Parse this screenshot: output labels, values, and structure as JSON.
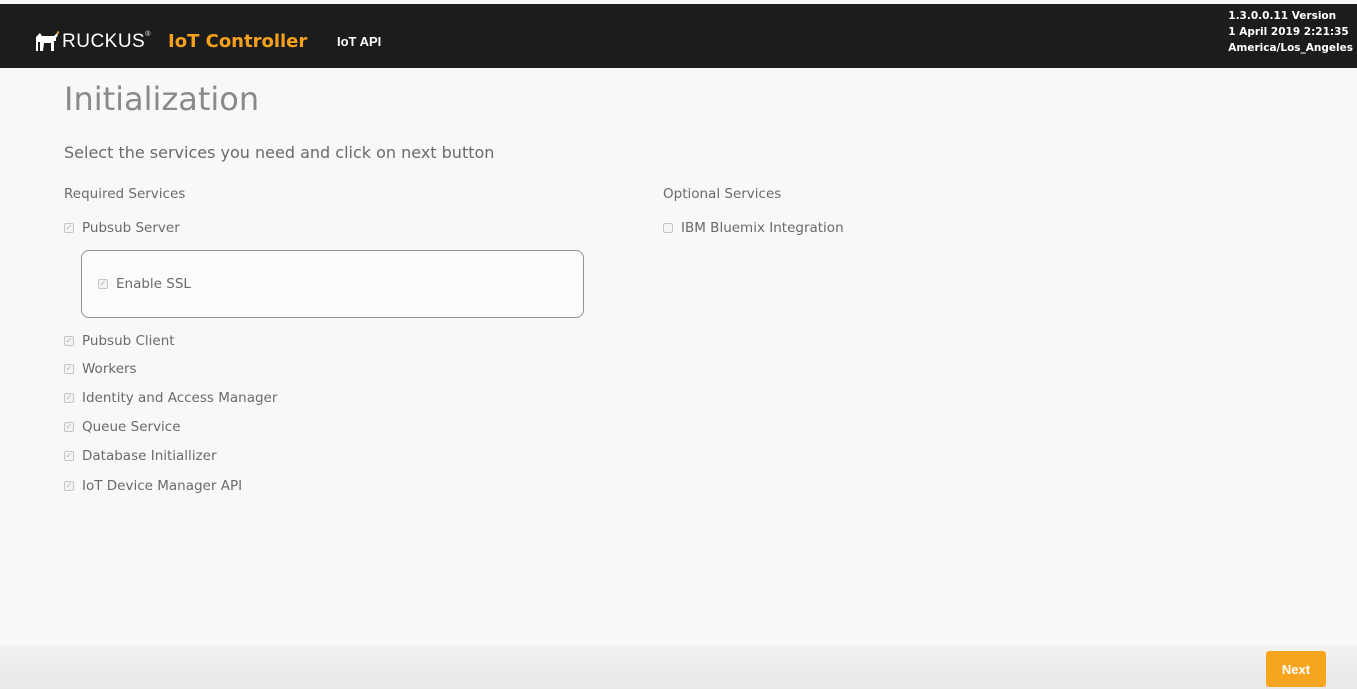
{
  "header": {
    "brand": "RUCKUS",
    "trademark": "®",
    "product": "IoT Controller",
    "nav_link": "IoT API",
    "version_line1": "1.3.0.0.11 Version",
    "version_line2": "1 April 2019 2:21:35",
    "version_line3": "America/Los_Angeles",
    "colors": {
      "bar": "#1c1c1c",
      "accent": "#f6a11e"
    }
  },
  "main": {
    "title": "Initialization",
    "instructions": "Select the services you need and click on next button",
    "required": {
      "heading": "Required Services",
      "items": [
        {
          "label": "Pubsub Server",
          "checked": true
        },
        {
          "label": "Enable SSL",
          "checked": true
        },
        {
          "label": "Pubsub Client",
          "checked": true
        },
        {
          "label": "Workers",
          "checked": true
        },
        {
          "label": "Identity and Access Manager",
          "checked": true
        },
        {
          "label": "Queue Service",
          "checked": true
        },
        {
          "label": "Database Initiallizer",
          "checked": true
        },
        {
          "label": "IoT Device Manager API",
          "checked": true
        }
      ]
    },
    "optional": {
      "heading": "Optional Services",
      "items": [
        {
          "label": "IBM Bluemix Integration",
          "checked": false
        }
      ]
    }
  },
  "footer": {
    "next_label": "Next",
    "colors": {
      "button": "#f7a51f"
    }
  }
}
